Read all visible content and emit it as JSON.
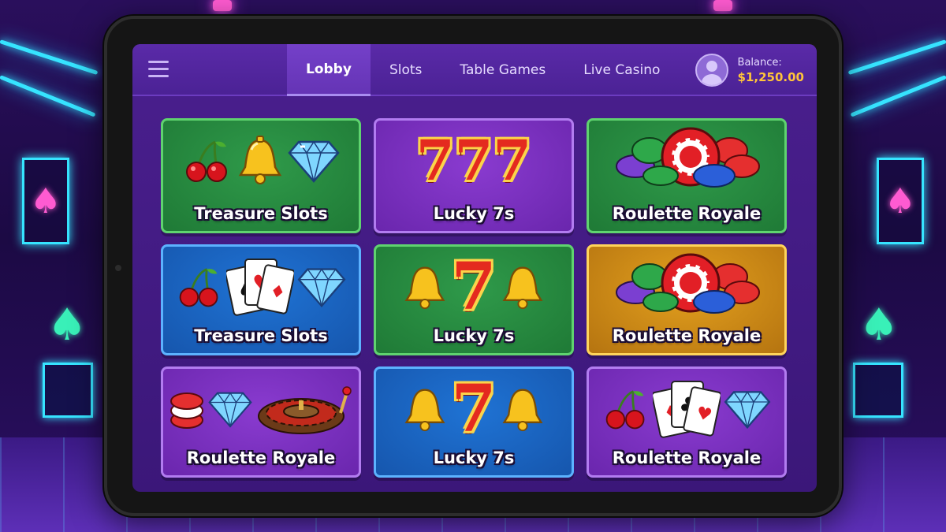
{
  "nav": {
    "menu_icon": "hamburger-menu-icon",
    "tabs": [
      {
        "label": "Lobby",
        "active": true
      },
      {
        "label": "Slots",
        "active": false
      },
      {
        "label": "Table Games",
        "active": false
      },
      {
        "label": "Live Casino",
        "active": false
      }
    ]
  },
  "account": {
    "avatar_icon": "user-avatar-icon",
    "balance_label": "Balance:",
    "balance_value": "$1,250.00"
  },
  "games": [
    {
      "title": "Treasure Slots",
      "theme": "green",
      "icons": [
        "cherries-icon",
        "bell-icon",
        "diamond-icon"
      ]
    },
    {
      "title": "Lucky 7s",
      "theme": "purple",
      "icons": [
        "triple-seven-icon"
      ]
    },
    {
      "title": "Roulette Royale",
      "theme": "green",
      "icons": [
        "casino-chips-icon"
      ]
    },
    {
      "title": "Treasure Slots",
      "theme": "blue",
      "icons": [
        "cherries-icon",
        "playing-cards-icon",
        "diamond-icon"
      ]
    },
    {
      "title": "Lucky 7s",
      "theme": "green",
      "icons": [
        "bell-icon",
        "seven-icon",
        "bell-icon"
      ]
    },
    {
      "title": "Roulette Royale",
      "theme": "gold",
      "icons": [
        "casino-chips-icon"
      ]
    },
    {
      "title": "Roulette Royale",
      "theme": "purple",
      "icons": [
        "casino-chips-icon",
        "diamond-icon",
        "roulette-wheel-icon"
      ]
    },
    {
      "title": "Lucky 7s",
      "theme": "blue",
      "icons": [
        "bell-icon",
        "seven-icon",
        "bell-icon"
      ]
    },
    {
      "title": "Roulette Royale",
      "theme": "purple",
      "icons": [
        "cherries-icon",
        "playing-cards-icon",
        "diamond-icon"
      ]
    }
  ],
  "colors": {
    "accent_gold": "#ffc43a",
    "nav_active": "#6534b5",
    "neon_cyan": "#36e4ff",
    "neon_pink": "#ff5bd1"
  }
}
